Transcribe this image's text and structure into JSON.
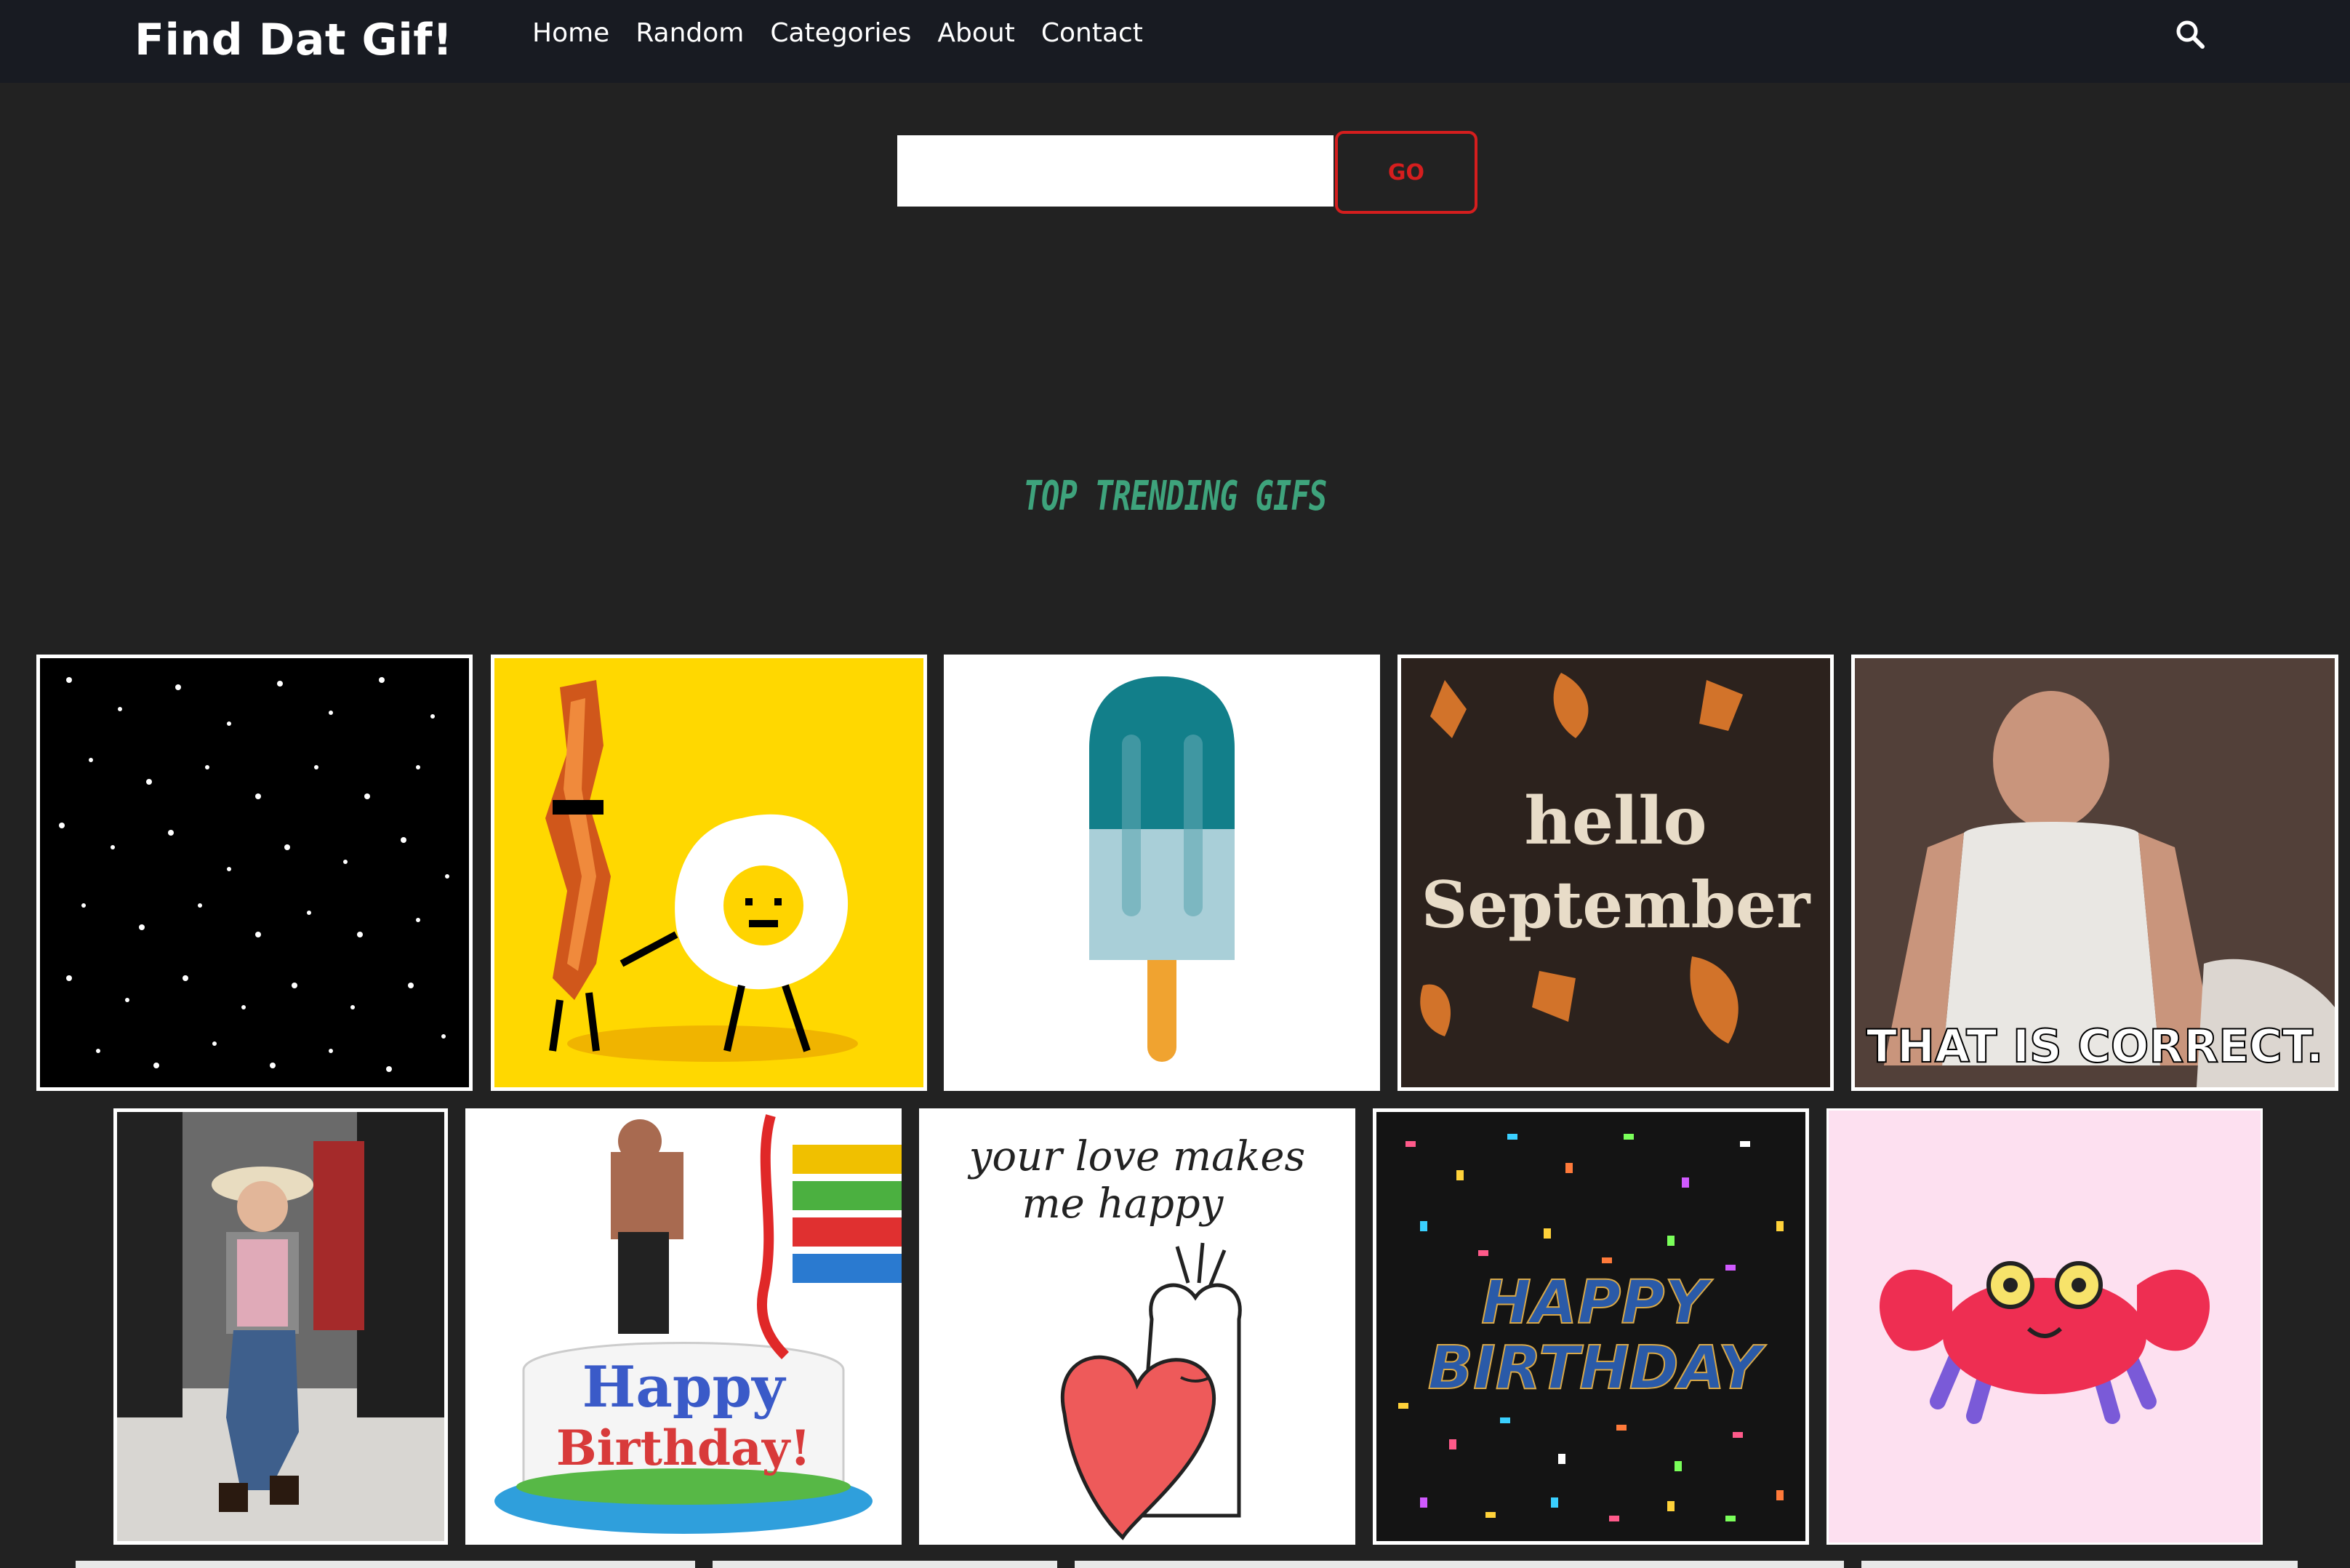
{
  "nav": {
    "brand": "Find Dat Gif!",
    "links": [
      "Home",
      "Random",
      "Categories",
      "About",
      "Contact"
    ]
  },
  "search": {
    "placeholder": "",
    "value": "",
    "go_label": "GO"
  },
  "section": {
    "title": "TOP TRENDING GIFS"
  },
  "gifs": {
    "hello_september": {
      "line1": "hello",
      "line2": "September"
    },
    "that_is_correct": {
      "caption": "THAT IS CORRECT."
    },
    "love_makes_happy": {
      "line1": "your love makes",
      "line2": "me happy"
    },
    "happy_birthday_confetti": {
      "line1": "HAPPY",
      "line2": "BIRTHDAY"
    },
    "birthday_cake": {
      "line1": "Happy",
      "line2": "Birthday!"
    }
  },
  "colors": {
    "nav_bg": "#181b22",
    "page_bg": "#222222",
    "accent_red": "#d51e1e",
    "title_green": "#3ea37c"
  }
}
